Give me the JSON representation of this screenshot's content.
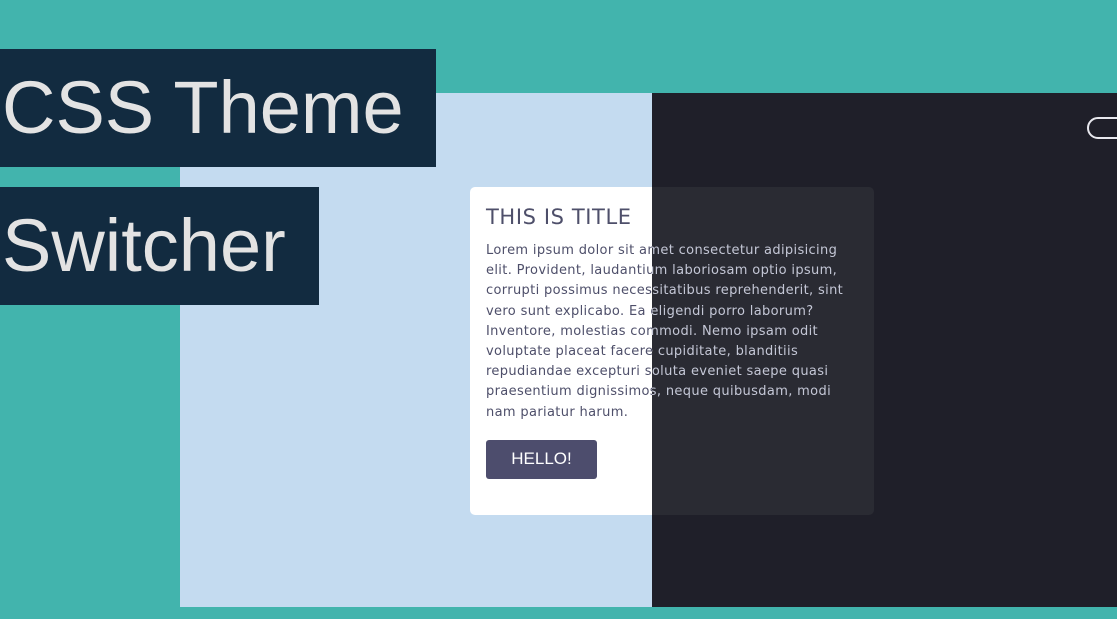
{
  "headline": {
    "line1": "CSS Theme",
    "line2": "Switcher"
  },
  "card": {
    "title": "THIS IS TITLE",
    "body": "Lorem ipsum dolor sit amet consectetur adipisicing elit. Provident, laudantium laboriosam optio ipsum, corrupti possimus necessitatibus reprehenderit, sint vero sunt explicabo. Ea eligendi porro laborum? Inventore, molestias commodi. Nemo ipsam odit voluptate placeat facere cupiditate, blanditiis repudiandae excepturi soluta eveniet saepe quasi praesentium dignissimos, neque quibusdam, modi nam pariatur harum.",
    "button_label": "HELLO!"
  },
  "theme": {
    "light_background": "#c4dbf0",
    "dark_background": "#1f1f29",
    "page_background": "#42b4ad",
    "headline_background": "#122b40",
    "button_color": "#4d4d6d"
  },
  "toggle": {
    "icon": "theme-toggle-switch"
  }
}
